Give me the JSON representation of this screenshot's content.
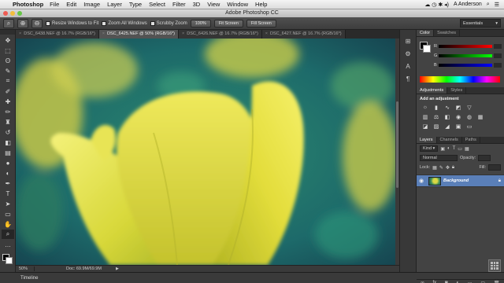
{
  "menubar": {
    "app_name": "Photoshop",
    "items": [
      "File",
      "Edit",
      "Image",
      "Layer",
      "Type",
      "Select",
      "Filter",
      "3D",
      "View",
      "Window",
      "Help"
    ],
    "user": "A Anderson"
  },
  "window": {
    "title": "Adobe Photoshop CC"
  },
  "options_bar": {
    "resize_windows": "Resize Windows to Fit",
    "zoom_all": "Zoom All Windows",
    "scrubby_zoom": "Scrubby Zoom",
    "btn_100": "100%",
    "btn_fit": "Fit Screen",
    "btn_fill": "Fill Screen",
    "workspace": "Essentials"
  },
  "tabs": [
    {
      "label": "DSC_6438.NEF @ 16.7% (RGB/16*)",
      "active": false
    },
    {
      "label": "DSC_6425.NEF @ 50% (RGB/16*)",
      "active": true
    },
    {
      "label": "DSC_6426.NEF @ 16.7% (RGB/16*)",
      "active": false
    },
    {
      "label": "DSC_6427.NEF @ 16.7% (RGB/16*)",
      "active": false
    }
  ],
  "status": {
    "zoom": "50%",
    "doc": "Doc: 69.9M/69.9M"
  },
  "timeline": {
    "label": "Timeline"
  },
  "panels": {
    "color_tabs": [
      "Color",
      "Swatches"
    ],
    "color_sliders": [
      {
        "label": "R",
        "gradient": [
          "#000000",
          "#ff0000"
        ]
      },
      {
        "label": "G",
        "gradient": [
          "#000000",
          "#00ff00"
        ]
      },
      {
        "label": "B",
        "gradient": [
          "#000000",
          "#0000ff"
        ]
      }
    ],
    "adjust_tabs": [
      "Adjustments",
      "Styles"
    ],
    "adjust_title": "Add an adjustment",
    "layers_tabs": [
      "Layers",
      "Channels",
      "Paths"
    ],
    "kind_label": "Kind",
    "blend_mode": "Normal",
    "opacity_label": "Opacity:",
    "lock_label": "Lock:",
    "fill_label": "Fill:",
    "layer_name": "Background"
  },
  "colors": {
    "accent_layer": "#5a7fb8"
  }
}
